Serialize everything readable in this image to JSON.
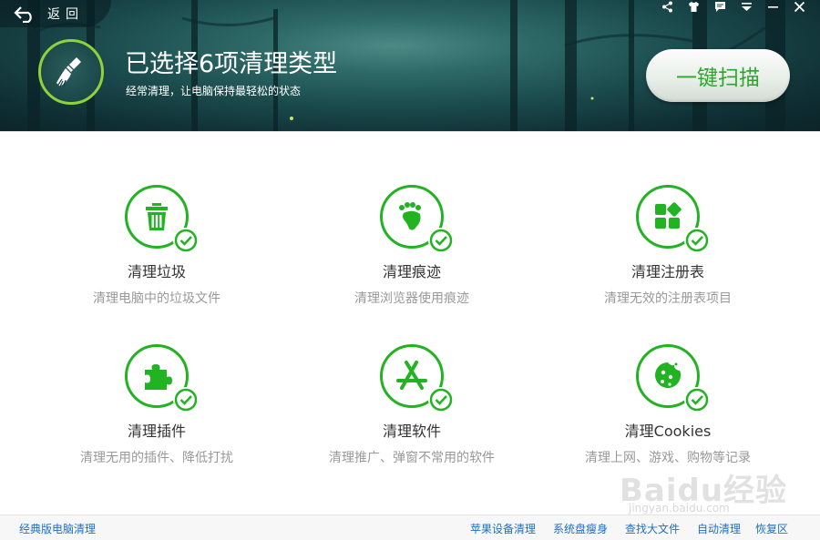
{
  "header": {
    "back_label": "返回",
    "title": "已选择6项清理类型",
    "subtitle": "经常清理，让电脑保持最轻松的状态",
    "scan_label": "一键扫描",
    "top_icons": [
      "share-icon",
      "skin-icon",
      "feedback-icon",
      "menu-icon",
      "minimize-icon",
      "close-icon"
    ]
  },
  "items": [
    {
      "title": "清理垃圾",
      "desc": "清理电脑中的垃圾文件",
      "icon": "trash-icon"
    },
    {
      "title": "清理痕迹",
      "desc": "清理浏览器使用痕迹",
      "icon": "footprint-icon"
    },
    {
      "title": "清理注册表",
      "desc": "清理无效的注册表项目",
      "icon": "registry-icon"
    },
    {
      "title": "清理插件",
      "desc": "清理无用的插件、降低打扰",
      "icon": "puzzle-icon"
    },
    {
      "title": "清理软件",
      "desc": "清理推广、弹窗不常用的软件",
      "icon": "app-store-icon"
    },
    {
      "title": "清理Cookies",
      "desc": "清理上网、游戏、购物等记录",
      "icon": "cookie-icon"
    }
  ],
  "footer": {
    "left_link": "经典版电脑清理",
    "links": [
      "苹果设备清理",
      "系统盘瘦身",
      "查找大文件",
      "自动清理",
      "恢复区"
    ]
  },
  "watermark": {
    "text": "Baidu经验",
    "url_text": "jingyan.baidu.com"
  },
  "colors": {
    "accent_green": "#22b322",
    "link_blue": "#1e6fc4",
    "header_teal": "#1b4b4d"
  }
}
